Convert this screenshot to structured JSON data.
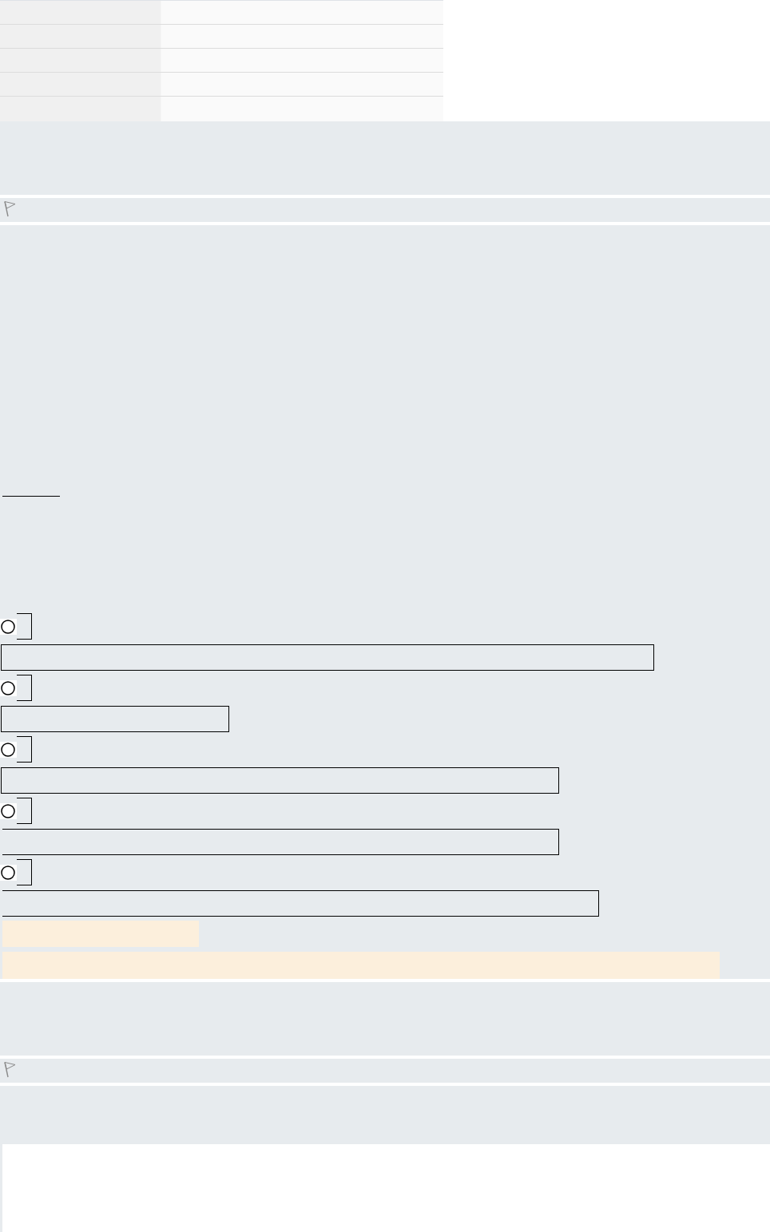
{
  "summary_table": {
    "rows": [
      {},
      {},
      {},
      {},
      {}
    ]
  },
  "questions": [
    {
      "flagged": false,
      "options": [
        {
          "selected": false
        },
        {
          "selected": false
        },
        {
          "selected": false
        },
        {
          "selected": false
        },
        {
          "selected": false
        }
      ]
    },
    {
      "flagged": false
    }
  ]
}
